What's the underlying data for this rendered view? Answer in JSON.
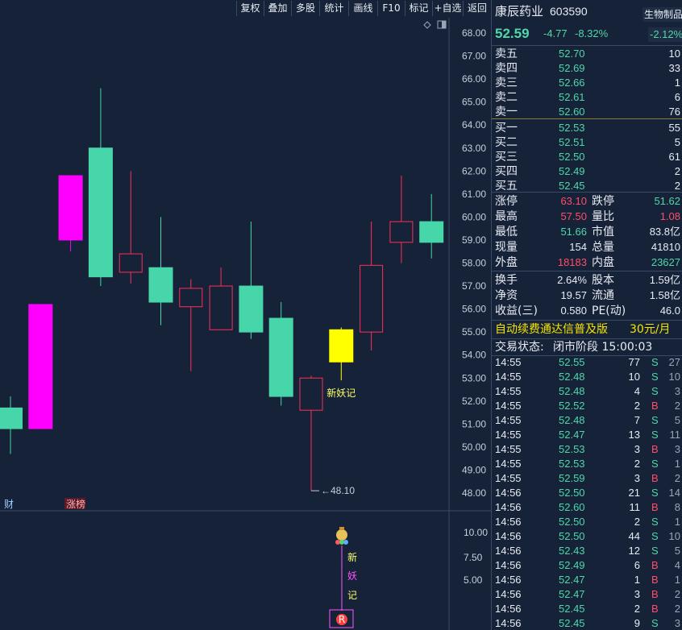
{
  "toolbar": {
    "items": [
      "复权",
      "叠加",
      "多股",
      "统计",
      "画线",
      "F10",
      "标记",
      "+自选",
      "返回"
    ]
  },
  "chart": {
    "y_ticks": [
      "68.00",
      "67.00",
      "66.00",
      "65.00",
      "64.00",
      "63.00",
      "62.00",
      "61.00",
      "60.00",
      "59.00",
      "58.00",
      "57.00",
      "56.00",
      "55.00",
      "54.00",
      "53.00",
      "52.00",
      "51.00",
      "50.00",
      "49.00",
      "48.00"
    ],
    "low_marker": "48.10",
    "annotation": "新妖记",
    "left_labels": [
      "财",
      "涨榜"
    ],
    "sub_ticks": [
      "10.00",
      "7.50",
      "5.00"
    ],
    "sub_chars": [
      "新",
      "妖",
      "记"
    ],
    "sub_badge": "R",
    "colors": {
      "up": "#ff2e5b",
      "down": "#47d6a9",
      "magenta": "#ff00ff",
      "yellow": "#ffff00",
      "bg": "#152238"
    }
  },
  "chart_data": {
    "type": "candlestick",
    "candles": [
      {
        "open": 51.7,
        "close": 50.8,
        "high": 52.2,
        "low": 49.7,
        "color": "down"
      },
      {
        "open": 50.8,
        "close": 56.2,
        "high": 56.2,
        "low": 50.8,
        "color": "magenta"
      },
      {
        "open": 59.0,
        "close": 61.8,
        "high": 61.8,
        "low": 58.5,
        "color": "magenta"
      },
      {
        "open": 63.0,
        "close": 57.4,
        "high": 65.6,
        "low": 57.0,
        "color": "down"
      },
      {
        "open": 57.6,
        "close": 58.4,
        "high": 62.0,
        "low": 57.1,
        "color": "up"
      },
      {
        "open": 57.8,
        "close": 56.3,
        "high": 60.0,
        "low": 55.3,
        "color": "down"
      },
      {
        "open": 56.1,
        "close": 56.9,
        "high": 57.3,
        "low": 53.3,
        "color": "up"
      },
      {
        "open": 55.1,
        "close": 57.0,
        "high": 57.8,
        "low": 55.1,
        "color": "up"
      },
      {
        "open": 57.0,
        "close": 55.0,
        "high": 59.8,
        "low": 54.7,
        "color": "down"
      },
      {
        "open": 55.6,
        "close": 52.2,
        "high": 56.3,
        "low": 51.8,
        "color": "down"
      },
      {
        "open": 51.6,
        "close": 53.0,
        "high": 53.1,
        "low": 48.1,
        "color": "up"
      },
      {
        "open": 53.7,
        "close": 55.1,
        "high": 55.2,
        "low": 52.9,
        "color": "yellow"
      },
      {
        "open": 55.0,
        "close": 57.9,
        "high": 59.8,
        "low": 54.2,
        "color": "up"
      },
      {
        "open": 58.9,
        "close": 59.8,
        "high": 61.8,
        "low": 58.0,
        "color": "up"
      },
      {
        "open": 59.8,
        "close": 58.9,
        "high": 61.0,
        "low": 58.2,
        "color": "down"
      }
    ],
    "ylim": [
      48.0,
      68.0
    ]
  },
  "quote": {
    "name": "康辰药业",
    "code": "603590",
    "sector": "生物制品",
    "price": "52.59",
    "change": "-4.77",
    "change_pct": "-8.32%",
    "sector_pct": "-2.12%"
  },
  "order_book": [
    {
      "label": "卖五",
      "price": "52.70",
      "vol": "10"
    },
    {
      "label": "卖四",
      "price": "52.69",
      "vol": "33"
    },
    {
      "label": "卖三",
      "price": "52.66",
      "vol": "1"
    },
    {
      "label": "卖二",
      "price": "52.61",
      "vol": "6"
    },
    {
      "label": "卖一",
      "price": "52.60",
      "vol": "76"
    },
    {
      "label": "买一",
      "price": "52.53",
      "vol": "55"
    },
    {
      "label": "买二",
      "price": "52.51",
      "vol": "5"
    },
    {
      "label": "买三",
      "price": "52.50",
      "vol": "61"
    },
    {
      "label": "买四",
      "price": "52.49",
      "vol": "2"
    },
    {
      "label": "买五",
      "price": "52.45",
      "vol": "2"
    }
  ],
  "stats": [
    {
      "l1": "涨停",
      "v1": "63.10",
      "c1": "red",
      "l2": "跌停",
      "v2": "51.62",
      "c2": "green"
    },
    {
      "l1": "最高",
      "v1": "57.50",
      "c1": "red",
      "l2": "量比",
      "v2": "1.08",
      "c2": "red"
    },
    {
      "l1": "最低",
      "v1": "51.66",
      "c1": "green",
      "l2": "市值",
      "v2": "83.8亿",
      "c2": "white"
    },
    {
      "l1": "现量",
      "v1": "154",
      "c1": "white",
      "l2": "总量",
      "v2": "41810",
      "c2": "white"
    },
    {
      "l1": "外盘",
      "v1": "18183",
      "c1": "red",
      "l2": "内盘",
      "v2": "23627",
      "c2": "green"
    }
  ],
  "stats2": [
    {
      "l1": "换手",
      "v1": "2.64%",
      "l2": "股本",
      "v2": "1.59亿"
    },
    {
      "l1": "净资",
      "v1": "19.57",
      "l2": "流通",
      "v2": "1.58亿"
    },
    {
      "l1": "收益(三)",
      "v1": "0.580",
      "l2": "PE(动)",
      "v2": "46.0"
    }
  ],
  "promo": {
    "text": "自动续费通达信普及版",
    "price": "30元/月"
  },
  "status": {
    "label": "交易状态:",
    "value": "闭市阶段 15:00:03"
  },
  "ticks": [
    {
      "time": "14:55",
      "price": "52.55",
      "vol": "77",
      "side": "S",
      "extra": "27"
    },
    {
      "time": "14:55",
      "price": "52.48",
      "vol": "10",
      "side": "S",
      "extra": "10"
    },
    {
      "time": "14:55",
      "price": "52.48",
      "vol": "4",
      "side": "S",
      "extra": "3"
    },
    {
      "time": "14:55",
      "price": "52.52",
      "vol": "2",
      "side": "B",
      "extra": "2"
    },
    {
      "time": "14:55",
      "price": "52.48",
      "vol": "7",
      "side": "S",
      "extra": "5"
    },
    {
      "time": "14:55",
      "price": "52.47",
      "vol": "13",
      "side": "S",
      "extra": "11"
    },
    {
      "time": "14:55",
      "price": "52.53",
      "vol": "3",
      "side": "B",
      "extra": "3"
    },
    {
      "time": "14:55",
      "price": "52.53",
      "vol": "2",
      "side": "S",
      "extra": "1"
    },
    {
      "time": "14:55",
      "price": "52.59",
      "vol": "3",
      "side": "B",
      "extra": "2"
    },
    {
      "time": "14:56",
      "price": "52.50",
      "vol": "21",
      "side": "S",
      "extra": "14"
    },
    {
      "time": "14:56",
      "price": "52.60",
      "vol": "11",
      "side": "B",
      "extra": "8"
    },
    {
      "time": "14:56",
      "price": "52.50",
      "vol": "2",
      "side": "S",
      "extra": "1"
    },
    {
      "time": "14:56",
      "price": "52.50",
      "vol": "44",
      "side": "S",
      "extra": "10"
    },
    {
      "time": "14:56",
      "price": "52.43",
      "vol": "12",
      "side": "S",
      "extra": "5"
    },
    {
      "time": "14:56",
      "price": "52.49",
      "vol": "6",
      "side": "B",
      "extra": "4"
    },
    {
      "time": "14:56",
      "price": "52.47",
      "vol": "1",
      "side": "B",
      "extra": "1"
    },
    {
      "time": "14:56",
      "price": "52.47",
      "vol": "3",
      "side": "B",
      "extra": "2"
    },
    {
      "time": "14:56",
      "price": "52.45",
      "vol": "2",
      "side": "B",
      "extra": "2"
    },
    {
      "time": "14:56",
      "price": "52.45",
      "vol": "9",
      "side": "S",
      "extra": "3"
    }
  ]
}
